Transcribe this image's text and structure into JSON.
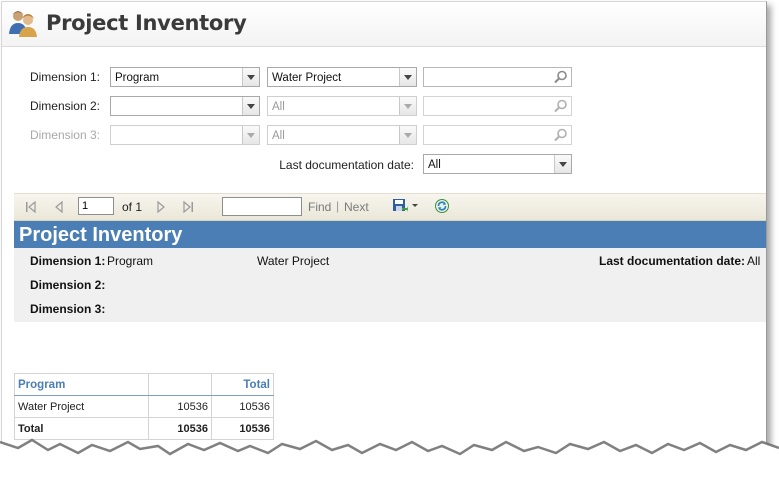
{
  "header": {
    "title": "Project Inventory",
    "icon": "users-icon"
  },
  "filters": {
    "dimension1": {
      "label": "Dimension 1:",
      "value": "Program",
      "sub_value": "Water Project",
      "lookup": ""
    },
    "dimension2": {
      "label": "Dimension 2:",
      "value": "",
      "sub_value": "All",
      "lookup": ""
    },
    "dimension3": {
      "label": "Dimension 3:",
      "value": "",
      "sub_value": "All",
      "lookup": ""
    },
    "last_doc_date": {
      "label": "Last documentation date:",
      "value": "All"
    }
  },
  "toolbar": {
    "page": "1",
    "of_label": "of 1",
    "find_placeholder": "",
    "find_label": "Find",
    "separator": "|",
    "next_label": "Next"
  },
  "report": {
    "title": "Project Inventory",
    "params": {
      "dimension1_label": "Dimension 1:",
      "dimension1_value": "Program",
      "dimension1_sub_value": "Water Project",
      "dimension2_label": "Dimension 2:",
      "dimension3_label": "Dimension 3:",
      "last_doc_date_label": "Last documentation date:",
      "last_doc_date_value": "All"
    },
    "table": {
      "headers": [
        "Program",
        "",
        "Total"
      ],
      "rows": [
        [
          "Water Project",
          "10536",
          "10536"
        ]
      ],
      "total": [
        "Total",
        "10536",
        "10536"
      ]
    }
  },
  "colors": {
    "report_title_bg": "#4a7eb5",
    "header_text": "#3a3a3a",
    "table_header_text": "#4a7eb5"
  }
}
